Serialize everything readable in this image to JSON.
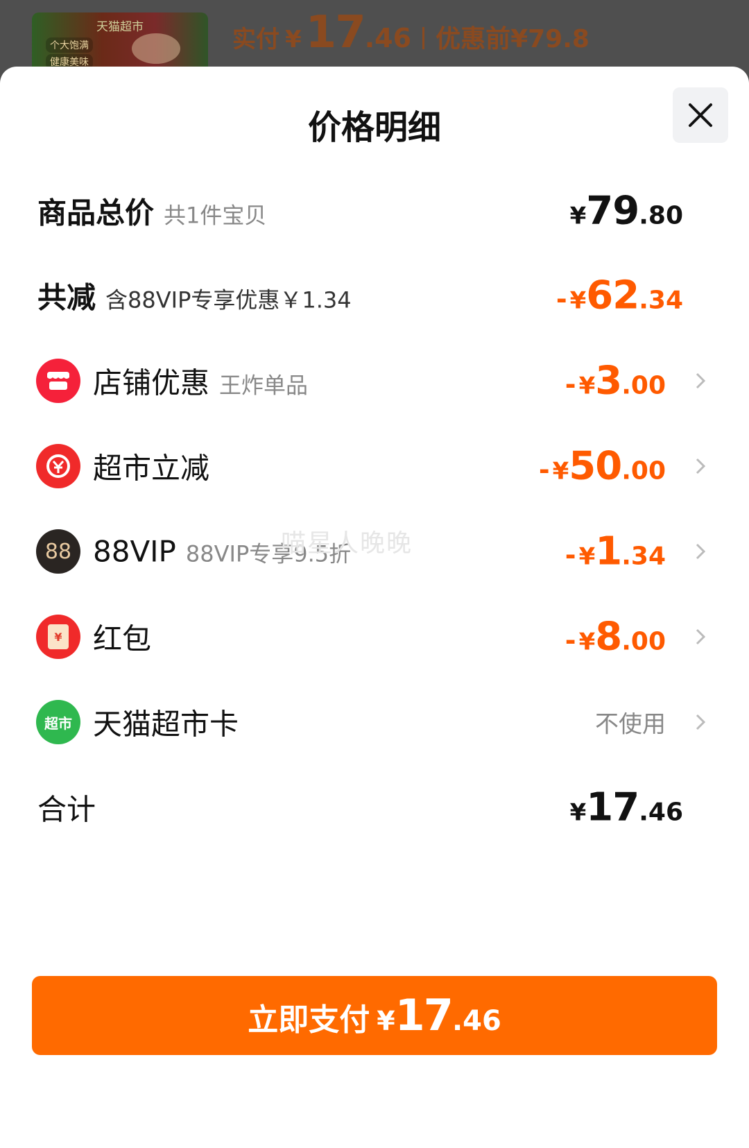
{
  "header": {
    "thumb_title": "天猫超市",
    "thumb_tag1": "个大饱满",
    "thumb_tag2": "健康美味",
    "paid_label": "实付",
    "currency": "¥",
    "paid_int": "17",
    "paid_dec": ".46",
    "before_label": "优惠前",
    "before_price": "¥79.8"
  },
  "sheet": {
    "title": "价格明细",
    "rows": {
      "total": {
        "label": "商品总价",
        "sub": "共1件宝贝",
        "yen": "¥",
        "int": "79",
        "dec": ".80"
      },
      "discount": {
        "label": "共减",
        "sub": "含88VIP专享优惠￥1.34",
        "neg": "-",
        "yen": "¥",
        "int": "62",
        "dec": ".34"
      },
      "shop": {
        "label": "店铺优惠",
        "sub": "王炸单品",
        "neg": "-",
        "yen": "¥",
        "int": "3",
        "dec": ".00"
      },
      "market": {
        "label": "超市立减",
        "neg": "-",
        "yen": "¥",
        "int": "50",
        "dec": ".00"
      },
      "vip": {
        "label": "88VIP",
        "sub": "88VIP专享9.5折",
        "icon_text": "88",
        "neg": "-",
        "yen": "¥",
        "int": "1",
        "dec": ".34"
      },
      "redpack": {
        "label": "红包",
        "icon_text": "¥",
        "neg": "-",
        "yen": "¥",
        "int": "8",
        "dec": ".00"
      },
      "card": {
        "label": "天猫超市卡",
        "icon_text": "超市",
        "value": "不使用"
      },
      "sum": {
        "label": "合计",
        "yen": "¥",
        "int": "17",
        "dec": ".46"
      }
    },
    "watermark": "喵星人晚晚",
    "pay_button": {
      "label": "立即支付",
      "yen": "¥",
      "int": "17",
      "dec": ".46"
    }
  },
  "colors": {
    "accent": "#ff6a00",
    "discount": "#ff5a00",
    "shop_icon": "#f5213a",
    "vip_icon": "#2a2522",
    "card_icon": "#2fb84f"
  }
}
